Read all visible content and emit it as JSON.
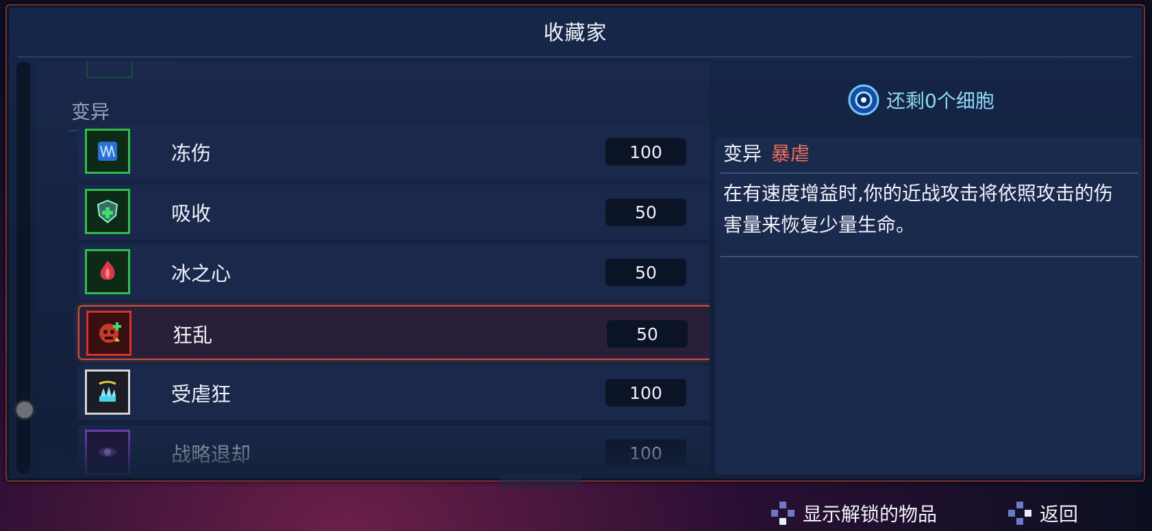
{
  "window": {
    "title": "收藏家"
  },
  "section": {
    "label": "变异"
  },
  "items": [
    {
      "name": "冻伤",
      "cost": "100",
      "icon": "frost-mutation-icon"
    },
    {
      "name": "吸收",
      "cost": "50",
      "icon": "shield-heal-icon"
    },
    {
      "name": "冰之心",
      "cost": "50",
      "icon": "heart-flame-icon"
    },
    {
      "name": "狂乱",
      "cost": "50",
      "icon": "frenzy-skull-icon",
      "selected": true
    },
    {
      "name": "受虐狂",
      "cost": "100",
      "icon": "masochist-crown-icon"
    },
    {
      "name": "战略退却",
      "cost": "100",
      "icon": "retreat-icon"
    }
  ],
  "cells": {
    "label": "还剩0个细胞",
    "icon": "cell-orb-icon"
  },
  "detail": {
    "type": "变异",
    "name": "暴虐",
    "description": "在有速度增益时,你的近战攻击将依照攻击的伤害量来恢复少量生命。"
  },
  "footer": {
    "show_unlocked": "显示解锁的物品",
    "back": "返回"
  },
  "colors": {
    "accent_red": "#c9563a",
    "name_highlight": "#f0705a",
    "cells_text": "#8fd8f2"
  }
}
